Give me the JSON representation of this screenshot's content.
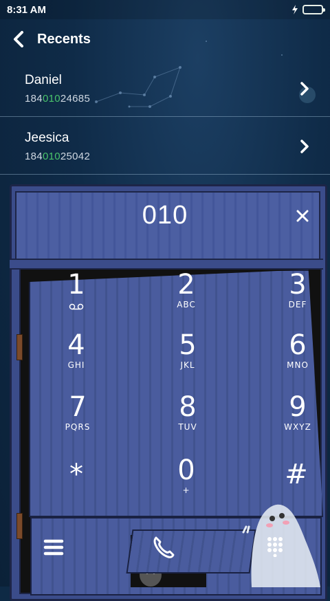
{
  "status_bar": {
    "time": "8:31 AM",
    "charging_icon": "bolt-icon",
    "battery_color": "#3fd24f"
  },
  "header": {
    "title": "Recents",
    "back_icon": "chevron-left-icon"
  },
  "recents": [
    {
      "name": "Daniel",
      "number_prefix": "184",
      "number_match": "010",
      "number_suffix": "24685"
    },
    {
      "name": "Jeesica",
      "number_prefix": "184",
      "number_match": "010",
      "number_suffix": "25042"
    }
  ],
  "dialer": {
    "input_value": "010",
    "clear_icon": "close-icon",
    "keys": [
      {
        "digit": "1",
        "letters": "",
        "sub_icon": "voicemail-icon"
      },
      {
        "digit": "2",
        "letters": "ABC"
      },
      {
        "digit": "3",
        "letters": "DEF"
      },
      {
        "digit": "4",
        "letters": "GHI"
      },
      {
        "digit": "5",
        "letters": "JKL"
      },
      {
        "digit": "6",
        "letters": "MNO"
      },
      {
        "digit": "7",
        "letters": "PQRS"
      },
      {
        "digit": "8",
        "letters": "TUV"
      },
      {
        "digit": "9",
        "letters": "WXYZ"
      },
      {
        "digit": "*",
        "letters": ""
      },
      {
        "digit": "0",
        "letters": "+"
      },
      {
        "digit": "#",
        "letters": ""
      }
    ],
    "menu_icon": "menu-icon",
    "call_icon": "phone-icon",
    "keypad_icon": "dialpad-icon"
  },
  "colors": {
    "match_highlight": "#49c36b",
    "background": "#0e2a45",
    "locker": "#4a5c9e"
  }
}
